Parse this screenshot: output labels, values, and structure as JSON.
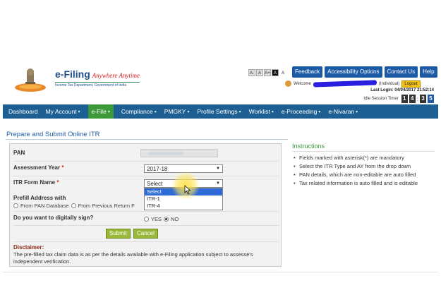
{
  "brand": {
    "name": "e-Filing",
    "tagline": "Anywhere Anytime",
    "department": "Income Tax Department, Government of India"
  },
  "font_size_buttons": [
    "A-",
    "A",
    "A+",
    "A",
    "A"
  ],
  "top_links": [
    "Feedback",
    "Accessibility Options",
    "Contact Us",
    "Help"
  ],
  "user": {
    "welcome": "Welcome",
    "role": "(Individual)",
    "logout": "Logout",
    "last_login_label": "Last Login:",
    "last_login_value": "04/04/2017 21:52:14",
    "idle_label": "Idle Session Timer",
    "idle_digits": [
      "1",
      "4",
      "3",
      "5"
    ]
  },
  "nav": {
    "items": [
      {
        "label": "Dashboard",
        "caret": false,
        "active": false
      },
      {
        "label": "My Account",
        "caret": true,
        "active": false
      },
      {
        "label": "e-File",
        "caret": true,
        "active": true
      },
      {
        "label": "Compliance",
        "caret": true,
        "active": false
      },
      {
        "label": "PMGKY",
        "caret": true,
        "active": false
      },
      {
        "label": "Profile Settings",
        "caret": true,
        "active": false
      },
      {
        "label": "Worklist",
        "caret": true,
        "active": false
      },
      {
        "label": "e-Proceeding",
        "caret": true,
        "active": false
      },
      {
        "label": "e-Nivaran",
        "caret": true,
        "active": false
      }
    ]
  },
  "page": {
    "title": "Prepare and Submit Online ITR"
  },
  "form": {
    "pan_label": "PAN",
    "ay_label": "Assessment Year",
    "ay_value": "2017-18",
    "itr_label": "ITR Form Name",
    "itr_value": "Select",
    "itr_options": [
      "Select",
      "ITR-1",
      "ITR-4"
    ],
    "prefill_label": "Prefill Address with",
    "prefill_options": [
      "From PAN Database",
      "From Previous Return F"
    ],
    "sign_label": "Do you want to digitally sign?",
    "sign_yes": "YES",
    "sign_no": "NO",
    "submit": "Submit",
    "cancel": "Cancel",
    "disclaimer_title": "Disclaimer:",
    "disclaimer_text": "The pre-filled tax claim data is as per the details available with e-Filing application subject to assesse's independent verification."
  },
  "instructions": {
    "title": "Instructions",
    "items": [
      "Fields marked with asterisk(*) are mandatory",
      "Select the ITR Type and AY from the drop down",
      "PAN details, which are non-editable are auto filled",
      "Tax related information is auto filled and is editable"
    ]
  },
  "colors": {
    "nav_bg": "#1d5f92",
    "nav_active": "#3c9a3a",
    "link_btn": "#1c5aa6",
    "logout": "#f2c014",
    "submit_btn": "#9ab83a",
    "dropdown_highlight": "#2f6bd4"
  }
}
